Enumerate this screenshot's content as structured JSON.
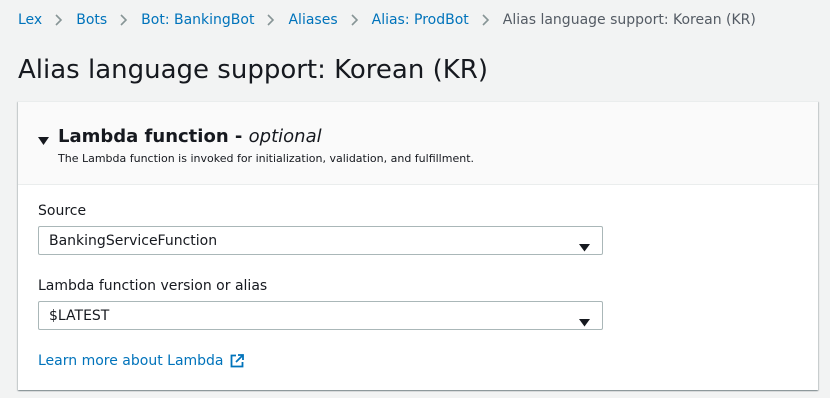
{
  "breadcrumb": {
    "items": [
      {
        "label": "Lex"
      },
      {
        "label": "Bots"
      },
      {
        "label": "Bot: BankingBot"
      },
      {
        "label": "Aliases"
      },
      {
        "label": "Alias: ProdBot"
      }
    ],
    "current": "Alias language support: Korean (KR)"
  },
  "page": {
    "title": "Alias language support: Korean (KR)"
  },
  "panel": {
    "title": "Lambda function -",
    "optional": "optional",
    "description": "The Lambda function is invoked for initialization, validation, and fulfillment.",
    "source_label": "Source",
    "source_value": "BankingServiceFunction",
    "version_label": "Lambda function version or alias",
    "version_value": "$LATEST",
    "learn_more": "Learn more about Lambda"
  },
  "icons": {
    "separator": "chevron-right-icon",
    "collapse": "caret-down-icon",
    "select": "caret-down-icon",
    "external": "external-link-icon"
  },
  "colors": {
    "link": "#0073bb",
    "text": "#16191f",
    "muted": "#545b64",
    "background": "#f2f3f3",
    "border": "#aab7b8"
  }
}
